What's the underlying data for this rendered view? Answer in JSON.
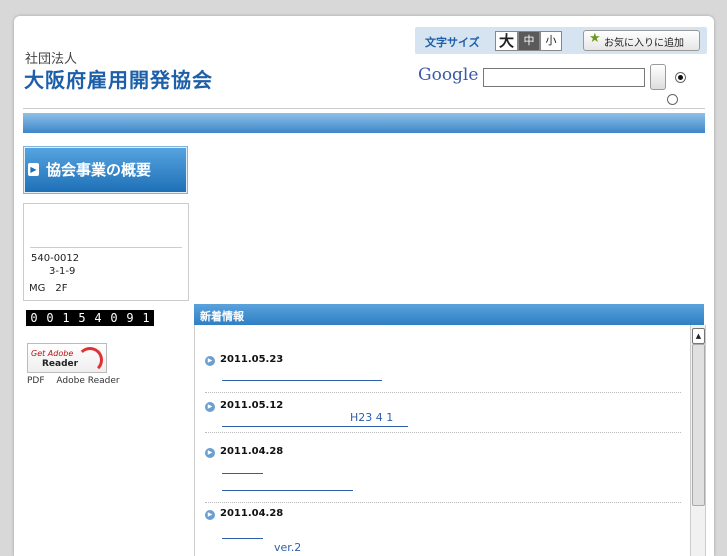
{
  "header": {
    "org_type": "社団法人",
    "org_name": "大阪府雇用開発協会"
  },
  "font_size": {
    "label": "文字サイズ",
    "large": "大",
    "medium": "中",
    "small": "小",
    "selected": "中"
  },
  "favorite_button": {
    "label": "お気に入りに追加",
    "icon": "star-icon"
  },
  "google": {
    "logo": "Google",
    "search_value": "",
    "radio_selected_index": 0
  },
  "sidebar": {
    "banner_title": "協会事業の概要",
    "info": {
      "postal": "540-0012",
      "address1": "3-1-9",
      "address2": "MG　2F"
    },
    "counter_digits": [
      "0",
      "0",
      "1",
      "5",
      "4",
      "0",
      "9",
      "1"
    ],
    "adobe": {
      "get": "Get Adobe",
      "reader": "Reader"
    },
    "pdf_note": "PDF　 Adobe Reader"
  },
  "news": {
    "title": "新着情報",
    "items": [
      {
        "date": "2011.05.23",
        "links": [
          ""
        ]
      },
      {
        "date": "2011.05.12",
        "links": [
          "H23 4 1"
        ]
      },
      {
        "date": "2011.04.28",
        "links": [
          "",
          ""
        ]
      },
      {
        "date": "2011.04.28",
        "links": [
          "",
          "ver.2"
        ]
      }
    ]
  },
  "colors": {
    "brand_blue": "#1d5fa8",
    "nav_blue": "#3d86c8",
    "link_blue": "#2d5fae"
  }
}
